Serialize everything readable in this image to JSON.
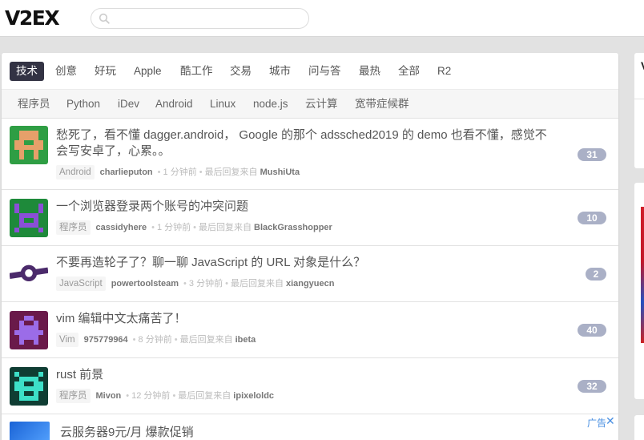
{
  "header": {
    "logo": "V2EX",
    "search_placeholder": ""
  },
  "tabs": [
    {
      "label": "技术",
      "active": true
    },
    {
      "label": "创意"
    },
    {
      "label": "好玩"
    },
    {
      "label": "Apple"
    },
    {
      "label": "酷工作"
    },
    {
      "label": "交易"
    },
    {
      "label": "城市"
    },
    {
      "label": "问与答"
    },
    {
      "label": "最热"
    },
    {
      "label": "全部"
    },
    {
      "label": "R2"
    }
  ],
  "subtabs": [
    "程序员",
    "Python",
    "iDev",
    "Android",
    "Linux",
    "node.js",
    "云计算",
    "宽带症候群"
  ],
  "topics": [
    {
      "title": "愁死了，看不懂 dagger.android， Google 的那个 adssched2019 的 demo 也看不懂，感觉不会写安卓了，心累。。",
      "node": "Android",
      "author": "charlieputon",
      "time": "1 分钟前",
      "last_reply_label": "最后回复来自",
      "last_reply_by": "MushiUta",
      "replies": "31",
      "avatar_color": "#2f9e44"
    },
    {
      "title": "一个浏览器登录两个账号的冲突问题",
      "node": "程序员",
      "author": "cassidyhere",
      "time": "1 分钟前",
      "last_reply_label": "最后回复来自",
      "last_reply_by": "BlackGrasshopper",
      "replies": "10",
      "avatar_color": "#1e8a3a"
    },
    {
      "title": "不要再造轮子了？聊一聊 JavaScript 的 URL 对象是什么？",
      "node": "JavaScript",
      "author": "powertoolsteam",
      "time": "3 分钟前",
      "last_reply_label": "最后回复来自",
      "last_reply_by": "xiangyuecn",
      "replies": "2",
      "avatar_color": "#4b2a6b"
    },
    {
      "title": "vim 编辑中文太痛苦了！",
      "node": "Vim",
      "author": "975779964",
      "time": "8 分钟前",
      "last_reply_label": "最后回复来自",
      "last_reply_by": "ibeta",
      "replies": "40",
      "avatar_color": "#6a1a4a"
    },
    {
      "title": "rust 前景",
      "node": "程序员",
      "author": "Mivon",
      "time": "12 分钟前",
      "last_reply_label": "最后回复来自",
      "last_reply_by": "ipixeloldc",
      "replies": "32",
      "avatar_color": "#0f3d33"
    }
  ],
  "ad": {
    "title": "云服务器9元/月 爆款促销",
    "label": "广告",
    "close": "✕"
  },
  "right_panel": {
    "initial": "V"
  }
}
